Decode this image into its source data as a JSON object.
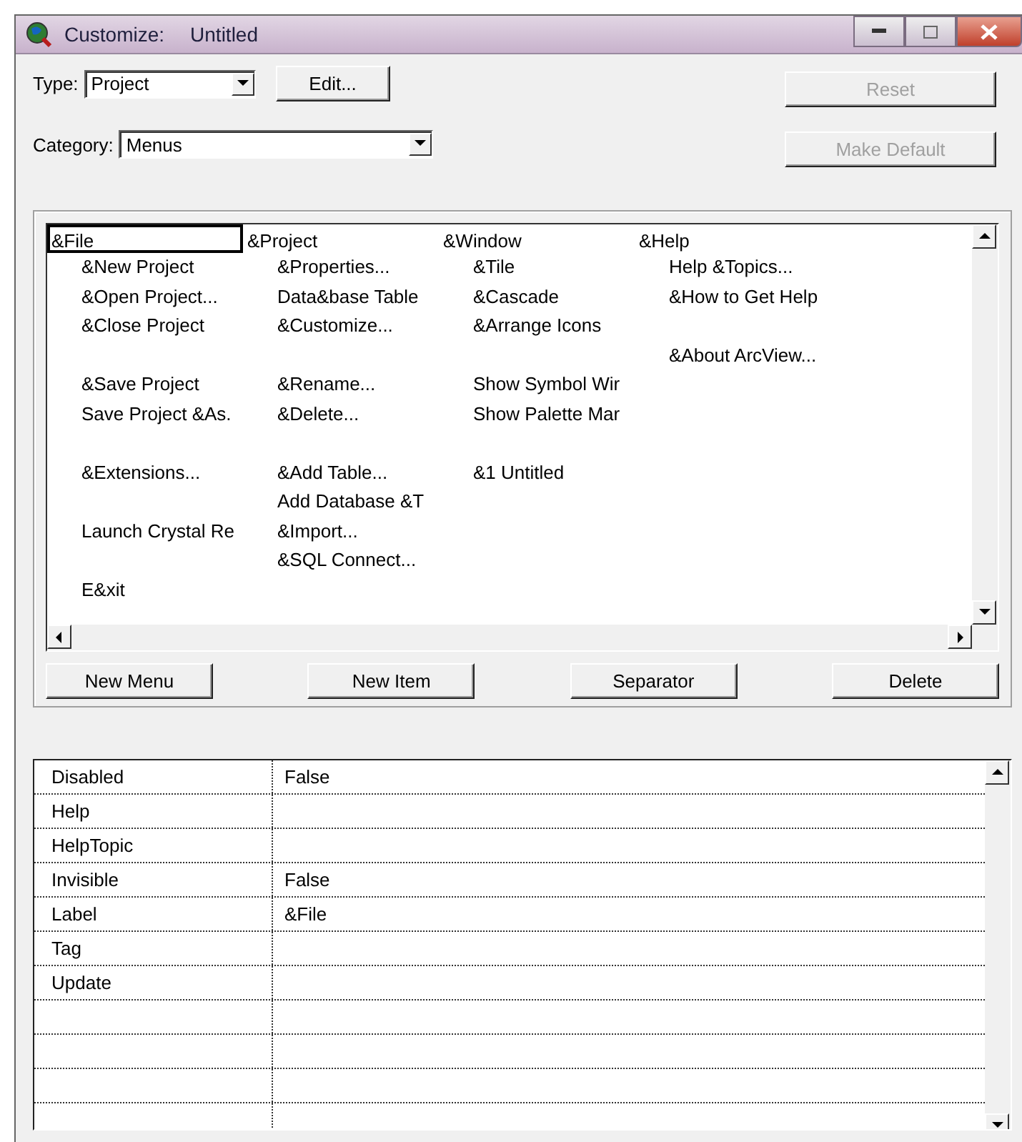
{
  "window": {
    "title": "Customize:",
    "document": "Untitled"
  },
  "type": {
    "label": "Type:",
    "value": "Project"
  },
  "category": {
    "label": "Category:",
    "value": "Menus"
  },
  "buttons_top": [
    {
      "label": "Edit...",
      "disabled": false
    }
  ],
  "buttons_side": [
    {
      "label": "Reset",
      "disabled": true
    },
    {
      "label": "Make Default",
      "disabled": true
    }
  ],
  "menus": [
    {
      "label": "&File",
      "selected": true,
      "items": [
        {
          "kind": "item",
          "label": "&New Project"
        },
        {
          "kind": "item",
          "label": "&Open Project..."
        },
        {
          "kind": "item",
          "label": "&Close Project"
        },
        {
          "kind": "separator"
        },
        {
          "kind": "item",
          "label": "&Save Project"
        },
        {
          "kind": "item",
          "label": "Save Project &As."
        },
        {
          "kind": "separator"
        },
        {
          "kind": "item",
          "label": "&Extensions..."
        },
        {
          "kind": "separator"
        },
        {
          "kind": "item",
          "label": "Launch Crystal Re"
        },
        {
          "kind": "separator"
        },
        {
          "kind": "item",
          "label": "E&xit"
        }
      ]
    },
    {
      "label": "&Project",
      "selected": false,
      "items": [
        {
          "kind": "item",
          "label": "&Properties..."
        },
        {
          "kind": "item",
          "label": "Data&base Table"
        },
        {
          "kind": "item",
          "label": "&Customize..."
        },
        {
          "kind": "separator"
        },
        {
          "kind": "item",
          "label": "&Rename..."
        },
        {
          "kind": "item",
          "label": "&Delete..."
        },
        {
          "kind": "separator"
        },
        {
          "kind": "item",
          "label": "&Add Table..."
        },
        {
          "kind": "item",
          "label": "Add Database &T"
        },
        {
          "kind": "item",
          "label": "&Import..."
        },
        {
          "kind": "item",
          "label": "&SQL Connect..."
        }
      ]
    },
    {
      "label": "&Window",
      "selected": false,
      "items": [
        {
          "kind": "item",
          "label": "&Tile"
        },
        {
          "kind": "item",
          "label": "&Cascade"
        },
        {
          "kind": "item",
          "label": "&Arrange Icons"
        },
        {
          "kind": "separator"
        },
        {
          "kind": "item",
          "label": "Show Symbol Wir"
        },
        {
          "kind": "item",
          "label": "Show Palette Mar"
        },
        {
          "kind": "separator"
        },
        {
          "kind": "item",
          "label": "&1 Untitled"
        }
      ]
    },
    {
      "label": "&Help",
      "selected": false,
      "items": [
        {
          "kind": "item",
          "label": "Help &Topics..."
        },
        {
          "kind": "item",
          "label": "&How to Get Help"
        },
        {
          "kind": "separator"
        },
        {
          "kind": "item",
          "label": "&About ArcView..."
        }
      ]
    }
  ],
  "buttons_menu": [
    "New Menu",
    "New Item",
    "Separator",
    "Delete"
  ],
  "properties": [
    {
      "name": "Disabled",
      "value": "False"
    },
    {
      "name": "Help"
    },
    {
      "name": "HelpTopic"
    },
    {
      "name": "Invisible",
      "value": "False"
    },
    {
      "name": "Label",
      "value": "&File"
    },
    {
      "name": "Tag"
    },
    {
      "name": "Update"
    }
  ]
}
